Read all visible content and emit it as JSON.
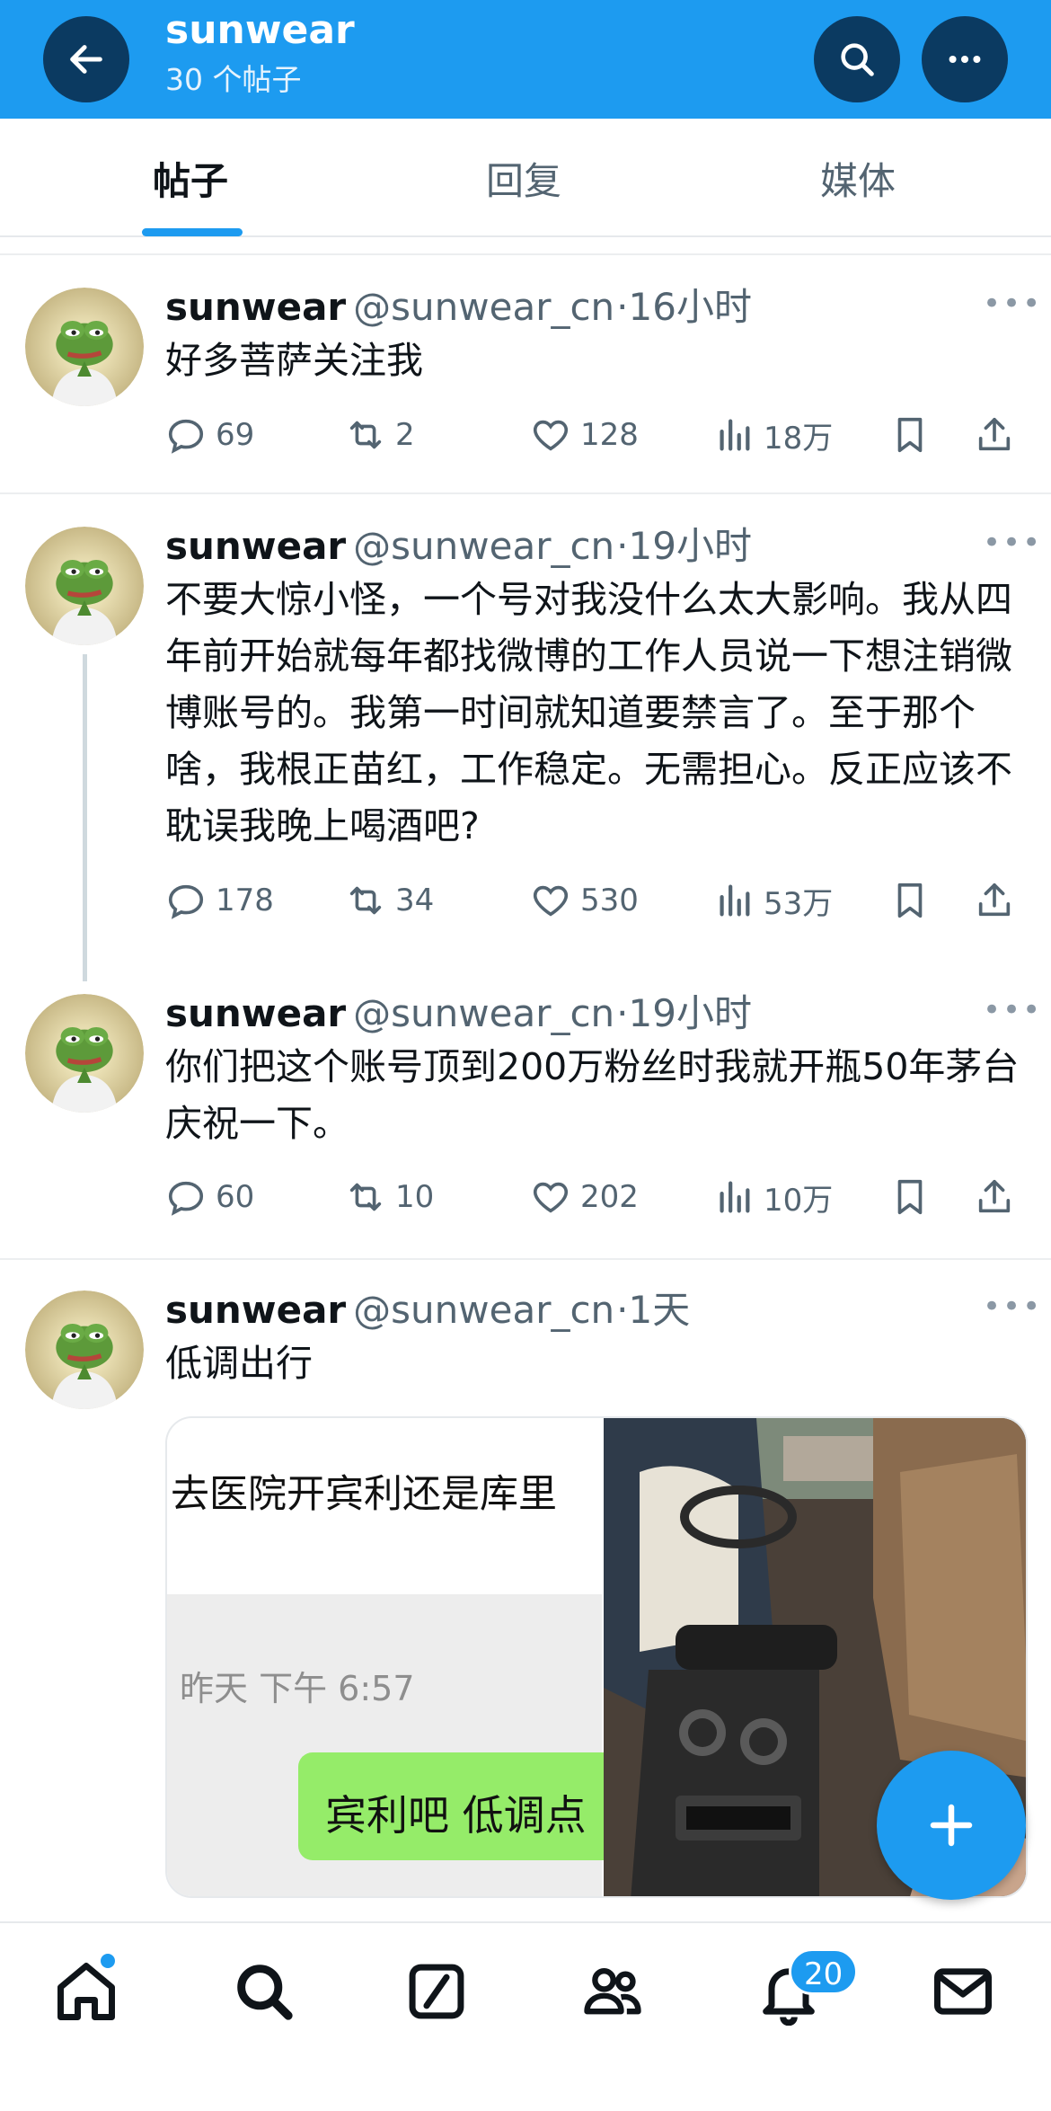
{
  "header": {
    "title": "sunwear",
    "subtitle": "30 个帖子",
    "icons": {
      "back": "arrow-left-icon",
      "search": "search-icon",
      "more": "more-horizontal-icon"
    }
  },
  "tabs": [
    {
      "label": "帖子",
      "active": true
    },
    {
      "label": "回复",
      "active": false
    },
    {
      "label": "媒体",
      "active": false
    }
  ],
  "tweets": [
    {
      "name": "sunwear",
      "handle": "@sunwear_cn",
      "time": "·16小时",
      "text": "好多菩萨关注我",
      "replies": "69",
      "retweets": "2",
      "likes": "128",
      "views": "18万"
    },
    {
      "name": "sunwear",
      "handle": "@sunwear_cn",
      "time": "·19小时",
      "text": "不要大惊小怪，一个号对我没什么太大影响。我从四年前开始就每年都找微博的工作人员说一下想注销微博账号的。我第一时间就知道要禁言了。至于那个啥，我根正苗红，工作稳定。无需担心。反正应该不耽误我晚上喝酒吧?",
      "replies": "178",
      "retweets": "34",
      "likes": "530",
      "views": "53万"
    },
    {
      "name": "sunwear",
      "handle": "@sunwear_cn",
      "time": "·19小时",
      "text": "你们把这个账号顶到200万粉丝时我就开瓶50年茅台庆祝一下。",
      "replies": "60",
      "retweets": "10",
      "likes": "202",
      "views": "10万"
    },
    {
      "name": "sunwear",
      "handle": "@sunwear_cn",
      "time": "·1天",
      "text": "低调出行",
      "media": {
        "chat_title": "去医院开宾利还是库里",
        "chat_time": "昨天 下午 6:57",
        "chat_bubble": "宾利吧 低调点"
      }
    }
  ],
  "bottom_nav": {
    "items": [
      "home-icon",
      "search-icon",
      "grok-icon",
      "communities-icon",
      "notifications-icon",
      "messages-icon"
    ],
    "notification_count": "20"
  },
  "colors": {
    "accent": "#1d9bf0",
    "header_button": "#0b3a61",
    "secondary_text": "#536471"
  }
}
